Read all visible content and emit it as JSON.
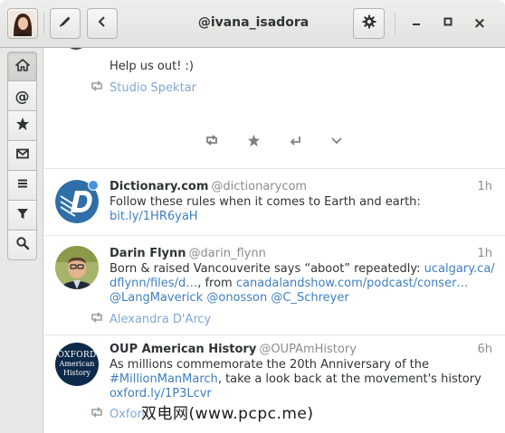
{
  "window": {
    "title": "@ivana_isadora",
    "close_label": "×"
  },
  "sidebar": {
    "tabs": [
      {
        "name": "home"
      },
      {
        "name": "mentions",
        "glyph": "@"
      },
      {
        "name": "favorites"
      },
      {
        "name": "messages"
      },
      {
        "name": "lists"
      },
      {
        "name": "filters"
      },
      {
        "name": "search"
      }
    ]
  },
  "timeline": {
    "partial_tweet": {
      "text": "Help us out! :)",
      "retweeted_by": "Studio Spektar"
    },
    "tweets": [
      {
        "name": "Dictionary.com",
        "handle": "@dictionarycom",
        "time": "1h",
        "text_line1": "Follow these rules when it comes to Earth and earth:",
        "link1": "bit.ly/1HR6yaH"
      },
      {
        "name": "Darin Flynn",
        "handle": "@darin_flynn",
        "time": "1h",
        "text_a": "Born & raised Vancouverite says “aboot” repeatedly: ",
        "link_a": "ucalgary.ca/",
        "link_b": "dflynn/files/d…",
        "text_b": ", from ",
        "link_c": "canadalandshow.com/podcast/conser…",
        "mention1": "@LangMaverick",
        "mention2": "@onosson",
        "mention3": "@C_Schreyer",
        "retweeted_by": "Alexandra D'Arcy"
      },
      {
        "name": "OUP American History",
        "handle": "@OUPAmHistory",
        "time": "6h",
        "text_line1": "As millions commemorate the 20th Anniversary of the",
        "hashtag": "#MillionManMarch",
        "text_line2": ", take a look back at the movement's history",
        "link1": "oxford.ly/1P3Lcvr",
        "retweeted_by": "Oxford",
        "avatar_text_1": "OXFORD",
        "avatar_text_2": "American",
        "avatar_text_3": "History"
      }
    ]
  },
  "watermark": "双电网(www.pcpc.me)",
  "colors": {
    "link": "#3f7fbf",
    "retweeter": "#7fa8d4",
    "dictionary_blue": "#2f6ea6",
    "oxford_navy": "#0e2a4a"
  }
}
